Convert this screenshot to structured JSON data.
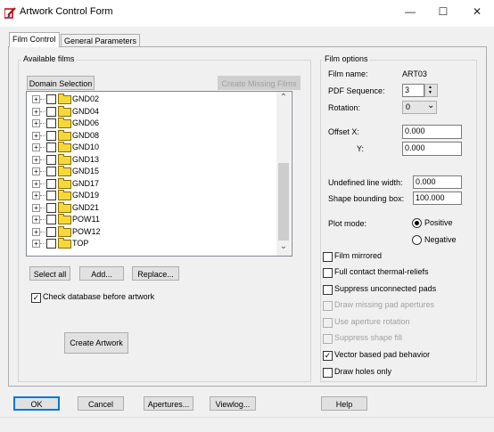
{
  "window": {
    "title": "Artwork Control Form",
    "minimize": "—",
    "maximize": "☐",
    "close": "✕"
  },
  "tabs": [
    {
      "label": "Film Control"
    },
    {
      "label": "General Parameters"
    }
  ],
  "available_films": {
    "group_label": "Available films",
    "domain_selection": "Domain Selection",
    "create_missing": "Create Missing Films",
    "films": [
      "GND02",
      "GND04",
      "GND06",
      "GND08",
      "GND10",
      "GND13",
      "GND15",
      "GND17",
      "GND19",
      "GND21",
      "POW11",
      "POW12",
      "TOP"
    ],
    "buttons": {
      "select_all": "Select all",
      "add": "Add...",
      "replace": "Replace..."
    },
    "check_db": {
      "label": "Check database before artwork",
      "checked": true
    },
    "create_artwork": "Create Artwork"
  },
  "film_options": {
    "group_label": "Film options",
    "film_name_label": "Film name:",
    "film_name": "ART03",
    "pdf_sequence_label": "PDF Sequence:",
    "pdf_sequence": "3",
    "rotation_label": "Rotation:",
    "rotation": "0",
    "offset_x_label": "Offset  X:",
    "offset_x": "0.000",
    "offset_y_label": "Y:",
    "offset_y": "0.000",
    "undefined_line_width_label": "Undefined line width:",
    "undefined_line_width": "0.000",
    "shape_bounding_box_label": "Shape bounding box:",
    "shape_bounding_box": "100.000",
    "plot_mode_label": "Plot mode:",
    "plot_mode": {
      "positive": "Positive",
      "negative": "Negative",
      "selected": "Positive"
    },
    "checkboxes": [
      {
        "label": "Film mirrored",
        "checked": false,
        "enabled": true
      },
      {
        "label": "Full contact thermal-reliefs",
        "checked": false,
        "enabled": true
      },
      {
        "label": "Suppress unconnected pads",
        "checked": false,
        "enabled": true
      },
      {
        "label": "Draw missing pad apertures",
        "checked": false,
        "enabled": false
      },
      {
        "label": "Use aperture rotation",
        "checked": false,
        "enabled": false
      },
      {
        "label": "Suppress shape fill",
        "checked": false,
        "enabled": false
      },
      {
        "label": "Vector based pad behavior",
        "checked": true,
        "enabled": true
      },
      {
        "label": "Draw holes only",
        "checked": false,
        "enabled": true
      }
    ]
  },
  "footer": {
    "ok": "OK",
    "cancel": "Cancel",
    "apertures": "Apertures...",
    "viewlog": "Viewlog...",
    "help": "Help"
  },
  "icons": {
    "plus": "+",
    "check": "✓",
    "scroll_up": "⌃",
    "scroll_down": "⌄",
    "spin_up": "▲",
    "spin_down": "▼",
    "dropdown": "⌄",
    "app_icon": "artwork-app-icon"
  },
  "colors": {
    "accent": "#0078d7",
    "folder": "#f5d93b",
    "window_bg": "#f0f0f0"
  }
}
